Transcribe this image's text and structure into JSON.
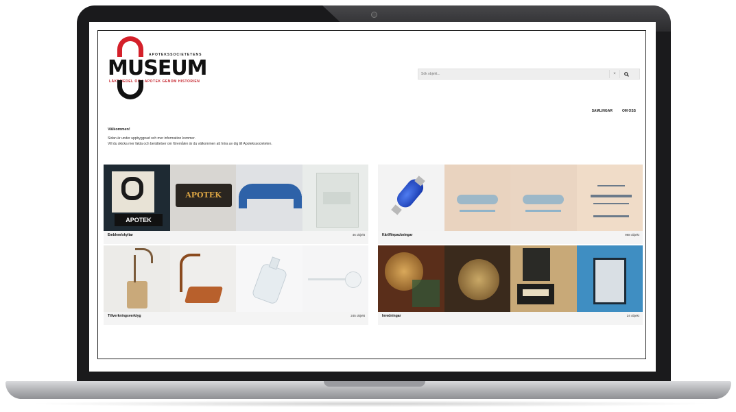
{
  "logo": {
    "top_line": "APOTEKSSOCIETETENS",
    "main": "MUSEUM",
    "sub": "LÄKEMEDEL OCH APOTEK GENOM HISTORIEN"
  },
  "search": {
    "placeholder": "Sök objekt...",
    "clear_label": "×",
    "go_icon": "search-icon"
  },
  "nav": {
    "items": [
      "SAMLINGAR",
      "OM OSS"
    ]
  },
  "intro": {
    "heading": "Välkommen!",
    "lines": [
      "Sidan är under uppbyggnad och mer information kommer.",
      "Vill du skicka mer fakta och berättelser om föremålen är du välkommen att höra av dig till Apotekssocieteten."
    ]
  },
  "cards": [
    {
      "title": "Emblem/skyltar",
      "count": "46 objekt"
    },
    {
      "title": "Kärl/förpackningar",
      "count": "968 objekt"
    },
    {
      "title": "Tillverkningsverktyg",
      "count": "245 objekt"
    },
    {
      "title": "Inredningar",
      "count": "24 objekt"
    }
  ],
  "colors": {
    "brand_red": "#d4202a",
    "logo_black": "#111111"
  }
}
